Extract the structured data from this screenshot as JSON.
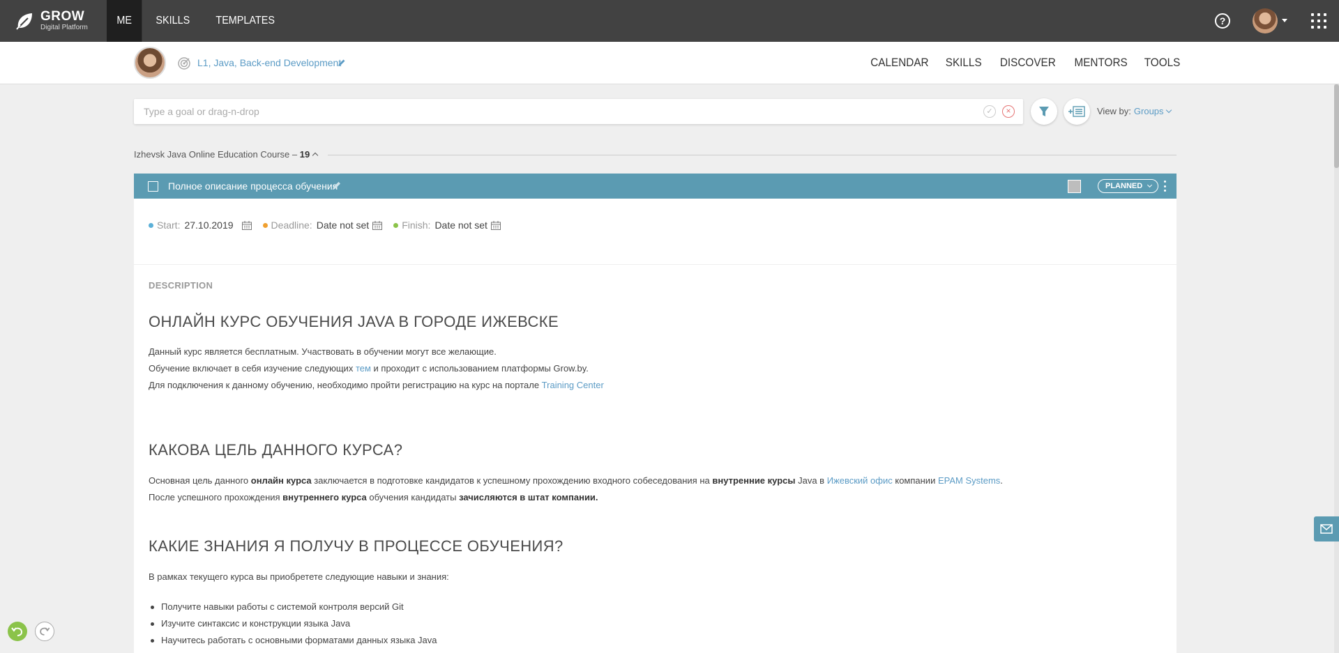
{
  "app": {
    "logo_title": "GROW",
    "logo_subtitle": "Digital Platform"
  },
  "topnav": {
    "items": [
      "ME",
      "SKILLS",
      "TEMPLATES"
    ],
    "active": "ME"
  },
  "subbar": {
    "goal_link": "L1, Java, Back-end Development",
    "nav": [
      "CALENDAR",
      "SKILLS",
      "DISCOVER",
      "MENTORS",
      "TOOLS"
    ]
  },
  "search": {
    "placeholder": "Type a goal or drag-n-drop",
    "value": ""
  },
  "view_by": {
    "label": "View by:",
    "value": "Groups"
  },
  "group": {
    "title": "Izhevsk Java Online Education Course",
    "separator": "–",
    "count": "19"
  },
  "card": {
    "title": "Полное описание процесса обучения",
    "status": "PLANNED",
    "dates": {
      "start_label": "Start:",
      "start_value": "27.10.2019",
      "deadline_label": "Deadline:",
      "deadline_value": "Date not set",
      "finish_label": "Finish:",
      "finish_value": "Date not set"
    },
    "description_label": "DESCRIPTION",
    "heading1": "ОНЛАЙН КУРС ОБУЧЕНИЯ JAVA В ГОРОДЕ ИЖЕВСКЕ",
    "p1_line1": "Данный курс является бесплатным. Участвовать в обучении могут все желающие.",
    "p1_line2_a": "Обучение включает в себя изучение следующих ",
    "p1_line2_link": "тем",
    "p1_line2_b": " и проходит с использованием платформы Grow.by.",
    "p1_line3_a": "Для подключения к данному обучению, необходимо пройти регистрацию на курс на портале ",
    "p1_line3_link": "Training Center",
    "heading2": "КАКОВА ЦЕЛЬ ДАННОГО КУРСА?",
    "p2_line1_a": "Основная цель данного ",
    "p2_line1_b1": "онлайн курса",
    "p2_line1_c": " заключается в подготовке кандидатов к успешному прохождению входного собеседования на ",
    "p2_line1_b2": "внутренние курсы",
    "p2_line1_d": " Java в ",
    "p2_line1_link1": "Ижевский офис",
    "p2_line1_e": " компании ",
    "p2_line1_link2": "EPAM Systems",
    "p2_line1_f": ".",
    "p2_line2_a": "После успешного прохождения ",
    "p2_line2_b1": "внутреннего курса",
    "p2_line2_c": " обучения кандидаты ",
    "p2_line2_b2": "зачисляются в штат компании.",
    "heading3": "КАКИЕ ЗНАНИЯ Я ПОЛУЧУ В ПРОЦЕССЕ ОБУЧЕНИЯ?",
    "p3": "В рамках текущего курса вы приобретете следующие навыки и знания:",
    "bullets": [
      "Получите навыки работы с системой контроля версий Git",
      "Изучите синтаксис и конструкции языка Java",
      "Научитесь работать с основными форматами данных языка Java"
    ]
  },
  "colors": {
    "topbar": "#424242",
    "card_header": "#5b9bb2",
    "link": "#5b9bc5",
    "start_dot": "#5bb0d8",
    "deadline_dot": "#f0a030",
    "finish_dot": "#8bc34a",
    "undo": "#8bc34a"
  },
  "icons": {
    "help": "question-icon",
    "apps": "apps-grid-icon",
    "filter": "filter-icon",
    "add_list": "add-list-icon",
    "feedback": "mail-icon",
    "undo": "undo-icon",
    "redo": "redo-icon"
  }
}
